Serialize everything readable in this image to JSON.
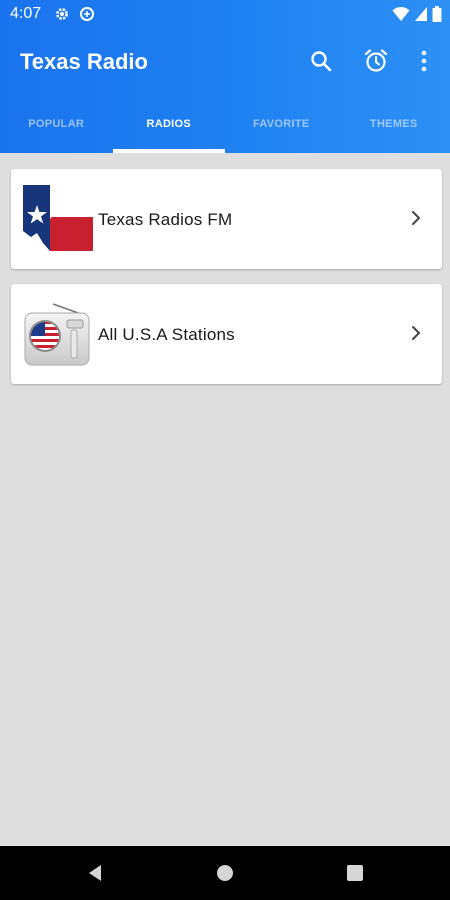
{
  "status_bar": {
    "time": "4:07",
    "left_icons": [
      "gear-icon",
      "data-saver-icon"
    ],
    "right_icons": [
      "wifi-icon",
      "signal-icon",
      "battery-icon"
    ]
  },
  "toolbar": {
    "title": "Texas Radio",
    "actions": [
      "search-icon",
      "alarm-icon",
      "more-vert-icon"
    ]
  },
  "tabs": [
    {
      "label": "POPULAR",
      "active": false
    },
    {
      "label": "RADIOS",
      "active": true
    },
    {
      "label": "FAVORITE",
      "active": false
    },
    {
      "label": "THEMES",
      "active": false
    }
  ],
  "items": [
    {
      "label": "Texas Radios FM",
      "icon": "texas-flag-map-icon"
    },
    {
      "label": "All U.S.A Stations",
      "icon": "usa-radio-icon"
    }
  ],
  "nav_bar": {
    "buttons": [
      "back-icon",
      "home-icon",
      "recents-icon"
    ]
  },
  "colors": {
    "primary": "#1f82f2",
    "background": "#dedede",
    "card": "#ffffff",
    "nav_bar": "#000000"
  }
}
